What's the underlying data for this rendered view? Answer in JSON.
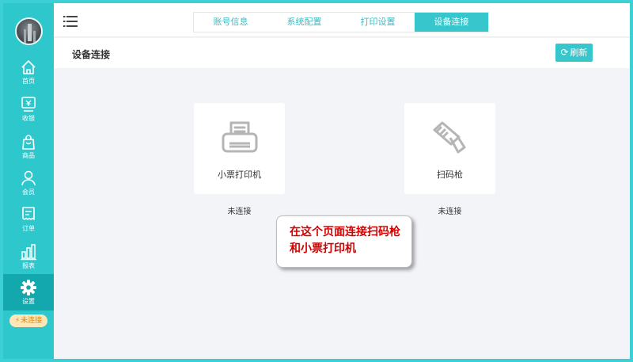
{
  "sidebar": {
    "items": [
      {
        "label": "首页",
        "icon": "home-icon"
      },
      {
        "label": "收银",
        "icon": "cash-register-icon"
      },
      {
        "label": "商品",
        "icon": "shopping-bag-icon"
      },
      {
        "label": "会员",
        "icon": "user-icon"
      },
      {
        "label": "订单",
        "icon": "receipt-icon"
      },
      {
        "label": "报表",
        "icon": "bar-chart-icon"
      },
      {
        "label": "设置",
        "icon": "gear-icon"
      }
    ],
    "active_item": "设置",
    "connection_status": "未连接"
  },
  "header": {
    "tabs": [
      {
        "label": "账号信息"
      },
      {
        "label": "系统配置"
      },
      {
        "label": "打印设置"
      },
      {
        "label": "设备连接"
      }
    ],
    "active_tab": "设备连接"
  },
  "page": {
    "title": "设备连接",
    "refresh_label": "刷新"
  },
  "devices": [
    {
      "name": "小票打印机",
      "status": "未连接",
      "icon": "printer-icon"
    },
    {
      "name": "扫码枪",
      "status": "未连接",
      "icon": "barcode-scanner-icon"
    }
  ],
  "callout": {
    "text": "在这个页面连接扫码枪和小票打印机"
  },
  "colors": {
    "accent": "#36c6cc",
    "sidebar": "#2ec7cc",
    "sidebar_active": "#13a8ad",
    "callout_text": "#d40000"
  }
}
